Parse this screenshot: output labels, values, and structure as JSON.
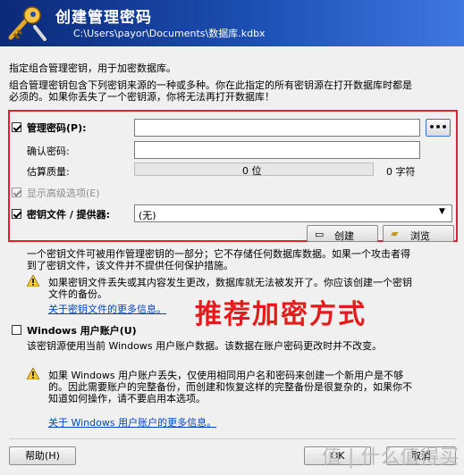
{
  "header": {
    "title": "创建管理密码",
    "path": "C:\\Users\\payor\\Documents\\数据库.kdbx"
  },
  "intro": {
    "line1": "指定组合管理密钥，用于加密数据库。",
    "line2": "组合管理密钥包含下列密钥来源的一种或多种。你在此指定的所有密钥源在打开数据库时都是",
    "line3": "必须的。如果你丢失了一个密钥源，你将无法再打开数据库！"
  },
  "password": {
    "label": "管理密码(P):",
    "reveal_label": "•••",
    "confirm_label": "确认密码:",
    "quality_label": "估算质量:",
    "quality_bits": "0 位",
    "quality_chars": "0 字符",
    "quality_value": 0,
    "advanced_label": "显示高级选项(E)"
  },
  "keyfile": {
    "label": "密钥文件 / 提供器:",
    "select_value": "(无)",
    "create_label": "创建",
    "browse_label": "浏览",
    "desc1": "一个密钥文件可被用作管理密钥的一部分；它不存储任何数据库数据。如果一个攻击者得",
    "desc2": "到了密钥文件，该文件并不提供任何保护措施。",
    "warn1": "如果密钥文件丢失或其内容发生更改，数据库就无法被发开了。你应该创建一个密钥",
    "warn2": "文件的备份。",
    "more_link": "关于密钥文件的更多信息。"
  },
  "windows": {
    "label": "Windows 用户账户(U)",
    "desc": "该密钥源使用当前 Windows 用户账户数据。该数据在账户密码更改时并不改变。",
    "warn1": "如果 Windows 用户账户丢失，仅使用相同用户名和密码来创建一个新用户是不够",
    "warn2": "的。因此需要账户的完整备份，而创建和恢复这样的完整备份是很复杂的，如果你不",
    "warn3": "知道如何操作，请不要启用本选项。",
    "more_link": "关于 Windows 用户账户的更多信息。"
  },
  "footer": {
    "help_label": "帮助(H)",
    "ok_label": "OK",
    "cancel_label": "取消"
  },
  "overlay_text": "推荐加密方式",
  "watermark": "值 | 什么值得买",
  "colors": {
    "banner_start": "#0b2a78",
    "banner_end": "#3f78e0",
    "highlight_red": "#e0222a",
    "link_blue": "#0044cc"
  }
}
